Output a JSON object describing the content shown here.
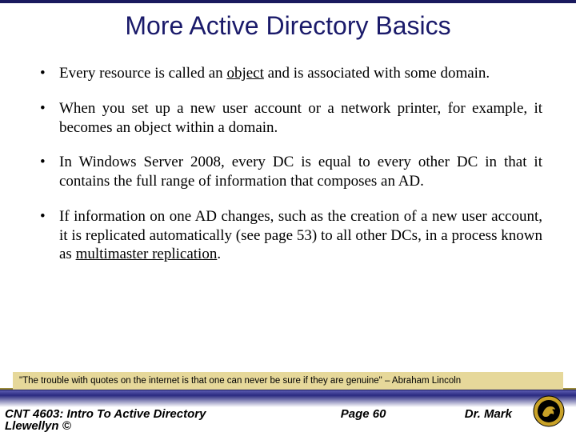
{
  "title": "More Active Directory Basics",
  "bullets": [
    {
      "pre": "Every resource is called an ",
      "u1": "object",
      "post": " and is associated with some domain."
    },
    {
      "pre": "When you set up a new user account or a network printer, for example, it becomes an object within a domain.",
      "u1": "",
      "post": ""
    },
    {
      "pre": "In Windows Server 2008, every DC is equal to every other DC in that it contains the full range of information that composes an AD.",
      "u1": "",
      "post": ""
    },
    {
      "pre": "If information on one AD changes, such as the creation of a new user account, it is replicated automatically (see page 53) to all other DCs, in a process known as ",
      "u1": "multimaster replication",
      "post": "."
    }
  ],
  "quote": "\"The trouble with quotes on the internet is that one can never be sure if they are genuine\" – Abraham Lincoln",
  "footer": {
    "course": "CNT 4603: Intro To Active Directory",
    "page": "Page 60",
    "author": "Dr. Mark",
    "copyright": "Llewellyn ©"
  }
}
